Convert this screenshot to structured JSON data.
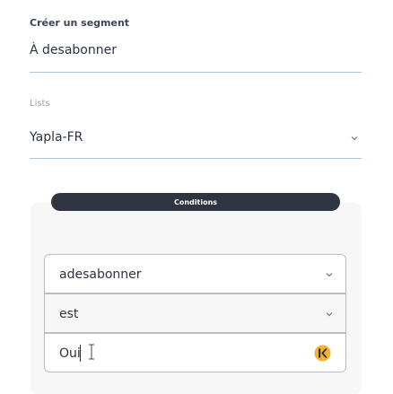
{
  "segment": {
    "label": "Créer un segment",
    "value": "À desabonner"
  },
  "lists": {
    "label": "Lists",
    "selected": "Yapla-FR"
  },
  "conditions": {
    "title": "Conditions",
    "field": "adesabonner",
    "operator": "est",
    "value": "Oui"
  },
  "colors": {
    "accent_line": "#a9c4d8",
    "pill_bg": "#2e3440",
    "keeper_icon": "#f2b233"
  },
  "icons": [
    "chevron-down-icon",
    "text-cursor-icon",
    "password-manager-icon"
  ]
}
